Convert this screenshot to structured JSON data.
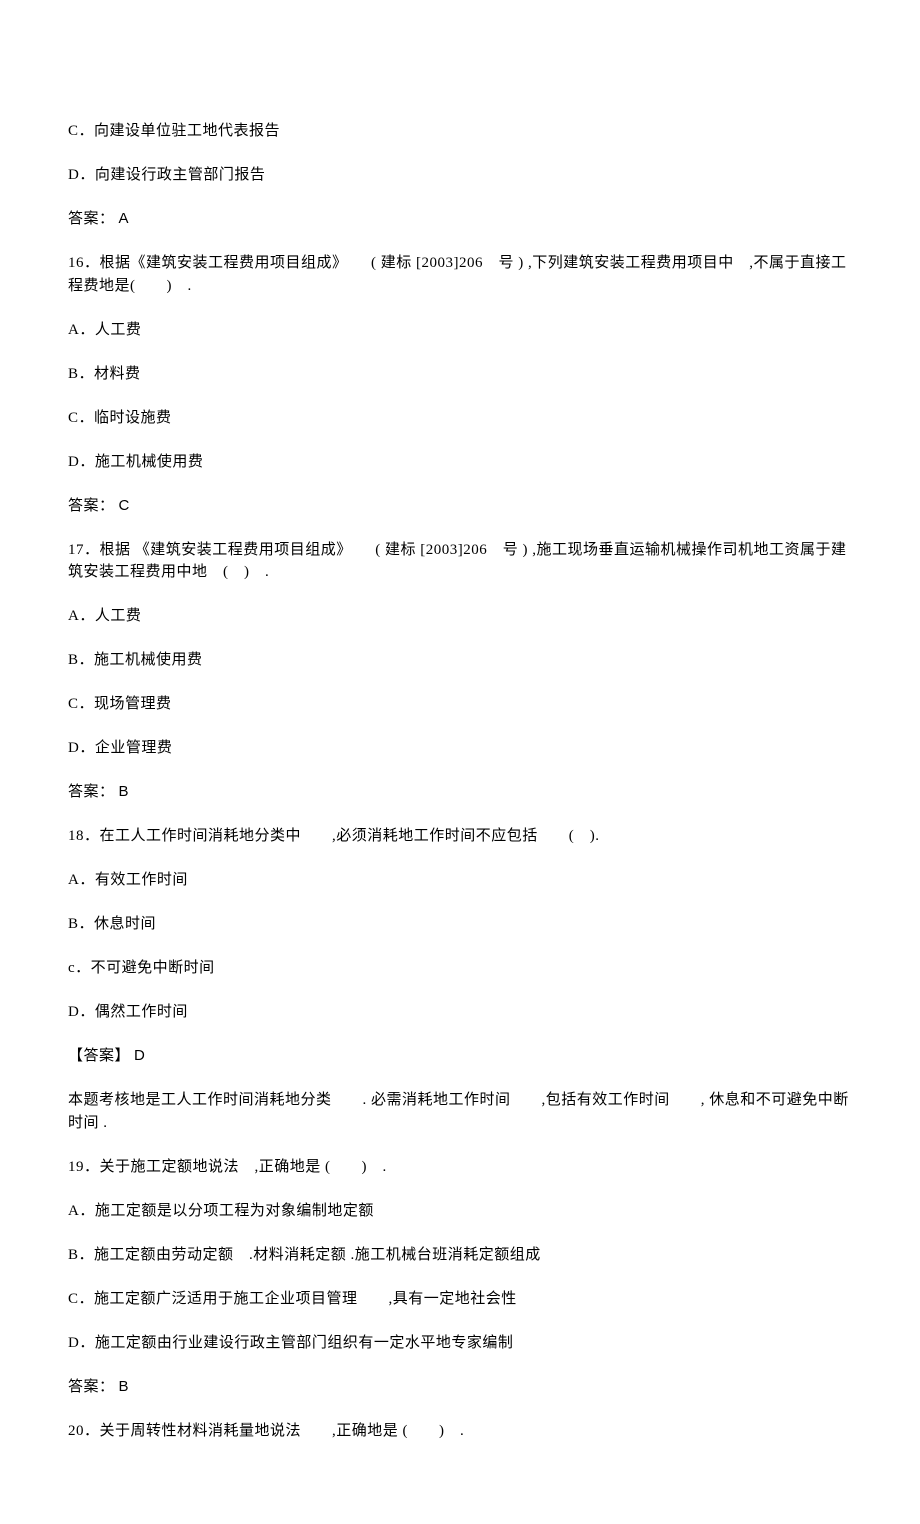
{
  "prevOptions": {
    "c": "C．向建设单位驻工地代表报告",
    "d": "D．向建设行政主管部门报告"
  },
  "prevAnswer": {
    "label": "答案：",
    "value": "A"
  },
  "q16": {
    "text": "16．根据《建筑安装工程费用项目组成》　　( 建标 [2003]206　号 ) ,下列建筑安装工程费用项目中　,不属于直接工程费地是(　　)　.",
    "options": {
      "a": "A．人工费",
      "b": "B．材料费",
      "c": "C．临时设施费",
      "d": "D．施工机械使用费"
    },
    "answer": {
      "label": "答案：",
      "value": "C"
    }
  },
  "q17": {
    "text": "17．根据 《建筑安装工程费用项目组成》　　( 建标 [2003]206　号 ) ,施工现场垂直运输机械操作司机地工资属于建筑安装工程费用中地　(　)　.",
    "options": {
      "a": "A．人工费",
      "b": "B．施工机械使用费",
      "c": "C．现场管理费",
      "d": "D．企业管理费"
    },
    "answer": {
      "label": "答案：",
      "value": "B"
    }
  },
  "q18": {
    "text": "18．在工人工作时间消耗地分类中　　,必须消耗地工作时间不应包括　　(　).",
    "options": {
      "a": "A．有效工作时间",
      "b": "B．休息时间",
      "c": "c．不可避免中断时间",
      "d": "D．偶然工作时间"
    },
    "answer": {
      "label": "【答案】",
      "value": "D"
    },
    "explanation": "本题考核地是工人工作时间消耗地分类　　. 必需消耗地工作时间　　,包括有效工作时间　　, 休息和不可避免中断时间 ."
  },
  "q19": {
    "text": "19．关于施工定额地说法　,正确地是 (　　)　.",
    "options": {
      "a": "A．施工定额是以分项工程为对象编制地定额",
      "b": "B．施工定额由劳动定额　.材料消耗定额 .施工机械台班消耗定额组成",
      "c": "C．施工定额广泛适用于施工企业项目管理　　,具有一定地社会性",
      "d": "D．施工定额由行业建设行政主管部门组织有一定水平地专家编制"
    },
    "answer": {
      "label": "答案：",
      "value": "B"
    }
  },
  "q20": {
    "text": "20．关于周转性材料消耗量地说法　　,正确地是 (　　)　."
  }
}
